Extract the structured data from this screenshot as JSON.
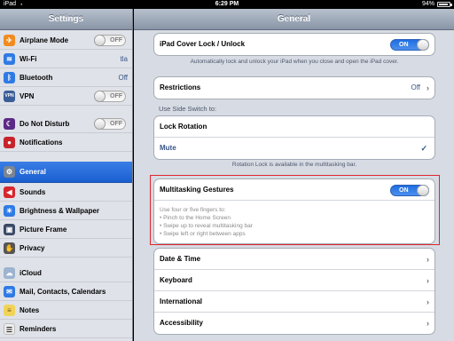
{
  "status_bar": {
    "carrier": "iPad",
    "time": "6:29 PM",
    "battery": "94%"
  },
  "left_panel": {
    "title": "Settings",
    "items": [
      {
        "label": "Airplane Mode",
        "toggle": "OFF"
      },
      {
        "label": "Wi-Fi",
        "value": "tla"
      },
      {
        "label": "Bluetooth",
        "value": "Off"
      },
      {
        "label": "VPN",
        "toggle": "OFF"
      },
      {
        "label": "Do Not Disturb",
        "toggle": "OFF"
      },
      {
        "label": "Notifications"
      },
      {
        "label": "General"
      },
      {
        "label": "Sounds"
      },
      {
        "label": "Brightness & Wallpaper"
      },
      {
        "label": "Picture Frame"
      },
      {
        "label": "Privacy"
      },
      {
        "label": "iCloud"
      },
      {
        "label": "Mail, Contacts, Calendars"
      },
      {
        "label": "Notes"
      },
      {
        "label": "Reminders"
      }
    ]
  },
  "right_panel": {
    "title": "General",
    "cover_lock": {
      "label": "iPad Cover Lock / Unlock",
      "toggle": "ON",
      "footnote": "Automatically lock and unlock your iPad when you close and open the iPad cover."
    },
    "restrictions": {
      "label": "Restrictions",
      "value": "Off"
    },
    "side_switch": {
      "header": "Use Side Switch to:",
      "options": [
        "Lock Rotation",
        "Mute"
      ],
      "footnote": "Rotation Lock is available in the multitasking bar."
    },
    "multitasking": {
      "label": "Multitasking Gestures",
      "toggle": "ON",
      "desc": [
        "Use four or five fingers to:",
        "• Pinch to the Home Screen",
        "• Swipe up to reveal multitasking bar",
        "• Swipe left or right between apps"
      ]
    },
    "nav_items": [
      "Date & Time",
      "Keyboard",
      "International",
      "Accessibility"
    ]
  }
}
